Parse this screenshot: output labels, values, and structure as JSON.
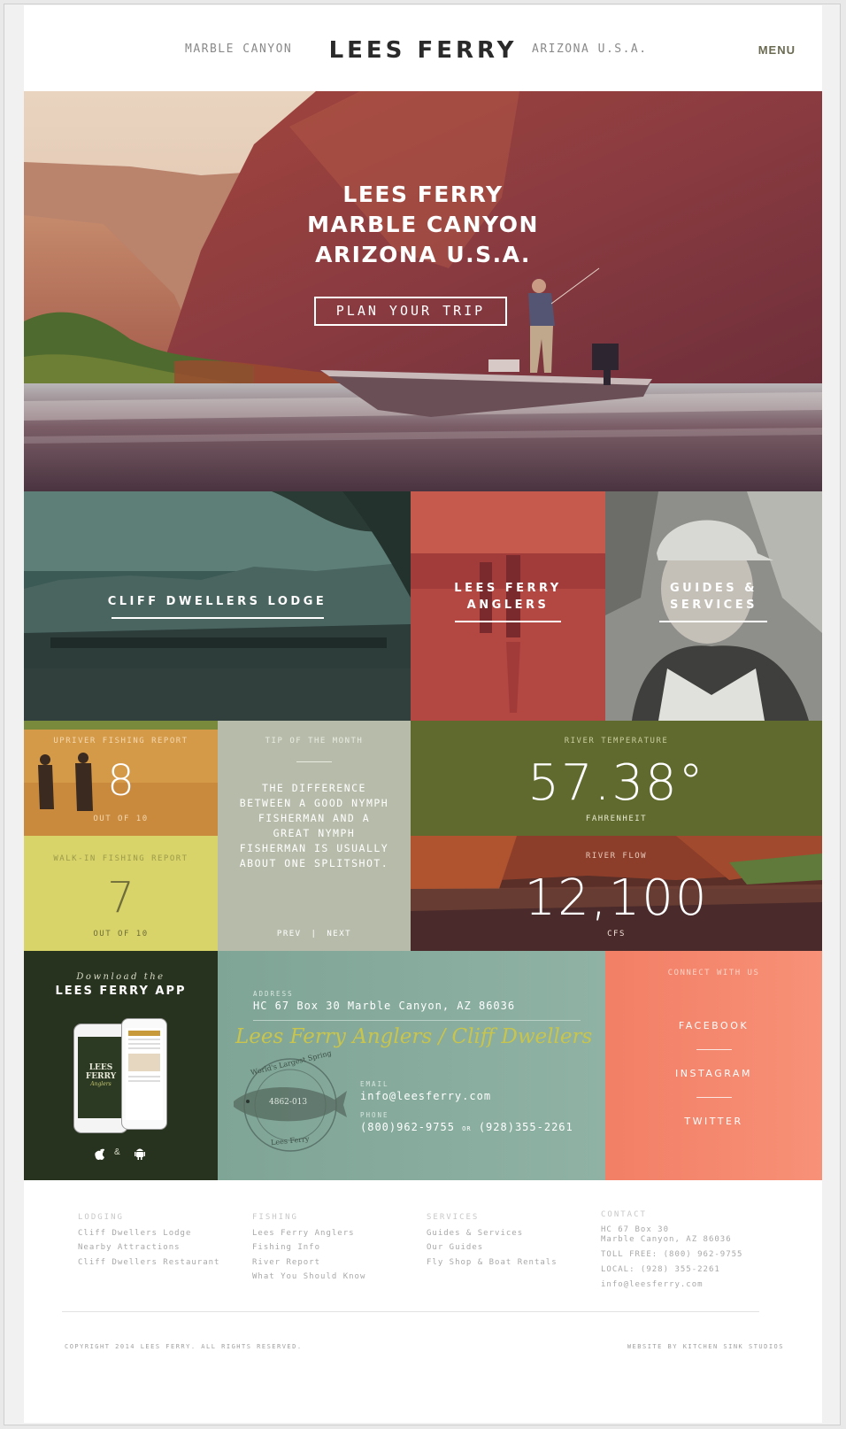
{
  "header": {
    "left": "MARBLE CANYON",
    "brand": "LEES FERRY",
    "right": "ARIZONA U.S.A.",
    "menu": "MENU"
  },
  "hero": {
    "line1": "LEES FERRY",
    "line2": "MARBLE CANYON",
    "line3": "ARIZONA U.S.A.",
    "cta": "PLAN YOUR TRIP"
  },
  "tiles": {
    "lodge": "CLIFF DWELLERS LODGE",
    "anglers_1": "LEES FERRY",
    "anglers_2": "ANGLERS",
    "guides_1": "GUIDES &",
    "guides_2": "SERVICES"
  },
  "reports": {
    "upriver_label": "UPRIVER FISHING REPORT",
    "upriver_value": "8",
    "upriver_scale": "OUT OF 10",
    "walkin_label": "WALK-IN FISHING REPORT",
    "walkin_value": "7",
    "walkin_scale": "OUT OF 10",
    "tip_label": "TIP OF THE MONTH",
    "tip_text": "THE DIFFERENCE BETWEEN A GOOD NYMPH FISHERMAN AND A GREAT NYMPH FISHERMAN IS USUALLY ABOUT ONE SPLITSHOT.",
    "prev": "PREV",
    "sep": "|",
    "next": "NEXT",
    "temp_label": "RIVER TEMPERATURE",
    "temp_value": "57.38°",
    "temp_unit": "FAHRENHEIT",
    "flow_label": "RIVER FLOW",
    "flow_value": "12,100",
    "flow_unit": "CFS"
  },
  "app": {
    "download": "Download the",
    "title": "LEES FERRY APP",
    "amp": "&",
    "phone_logo_1": "LEES",
    "phone_logo_2": "FERRY",
    "phone_logo_3": "Anglers"
  },
  "contact": {
    "address_label": "ADDRESS",
    "address": "HC 67 Box 30 Marble Canyon, AZ 86036",
    "script": "Lees Ferry Anglers / Cliff Dwellers",
    "email_label": "EMAIL",
    "email": "info@leesferry.com",
    "phone_label": "PHONE",
    "phone_1": "(800)962-9755",
    "phone_or": "OR",
    "phone_2": "(928)355-2261",
    "stamp_top": "World's Largest Spring",
    "stamp_bottom": "Lees Ferry",
    "stamp_number": "4862-013"
  },
  "social": {
    "label": "CONNECT WITH US",
    "facebook": "FACEBOOK",
    "instagram": "INSTAGRAM",
    "twitter": "TWITTER"
  },
  "footer": {
    "lodging": {
      "heading": "LODGING",
      "links": [
        "Cliff Dwellers Lodge",
        "Nearby Attractions",
        "Cliff Dwellers Restaurant"
      ]
    },
    "fishing": {
      "heading": "FISHING",
      "links": [
        "Lees Ferry Anglers",
        "Fishing Info",
        "River Report",
        "What You Should Know"
      ]
    },
    "services": {
      "heading": "SERVICES",
      "links": [
        "Guides & Services",
        "Our Guides",
        "Fly Shop & Boat Rentals"
      ]
    },
    "contact": {
      "heading": "CONTACT",
      "lines": [
        "HC 67 Box 30",
        "Marble Canyon, AZ 86036",
        "TOLL FREE: (800) 962-9755",
        "LOCAL: (928) 355-2261",
        "info@leesferry.com"
      ]
    },
    "copyright": "COPYRIGHT 2014 LEES FERRY. ALL RIGHTS RESERVED.",
    "credit": "WEBSITE BY KITCHEN SINK STUDIOS"
  },
  "colors": {
    "olive": "#606a2e",
    "teal": "#8aaea0",
    "coral": "#f4876b",
    "dark_green": "#28331f",
    "sage": "#b7bcaa",
    "yellow": "#d8d46a"
  }
}
